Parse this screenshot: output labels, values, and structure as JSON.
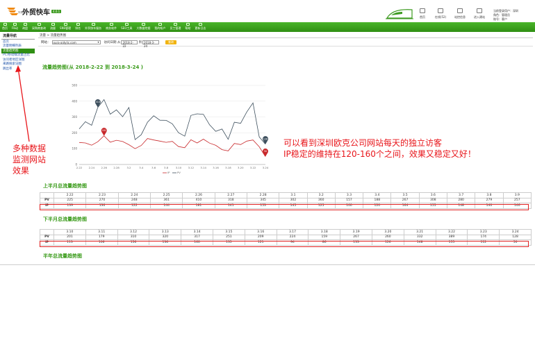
{
  "header": {
    "logo_text": "外贸快车",
    "logo_badge": "4.0.1",
    "logo_slogan": "外贸推广 快人一步",
    "top_links": [
      "首页",
      "在线(52)",
      "站控信息",
      "进入建站"
    ],
    "user_lines": [
      "当前登录用户：深圳",
      "角色：管理员",
      "账号：客户"
    ]
  },
  "nav": {
    "items": [
      "首页",
      "FB动",
      "询盘",
      "采购商查询",
      "流量",
      "SNS管理",
      "排名",
      "外贸快车服务",
      "商务软件",
      "SEO工具",
      "大数据挖掘",
      "我的帐户",
      "员工管理",
      "帮助",
      "更新日志"
    ]
  },
  "sidebar": {
    "title": "流量导航",
    "items": [
      "首页",
      "流量明细列表",
      "流量趋势图",
      "PC/移动端流量占比",
      "访问者地区详图",
      "来路搜索词图",
      "跳出率"
    ],
    "active_index": 2
  },
  "breadcrumb": {
    "home": "流量",
    "sep": " > ",
    "current": "流量趋势图"
  },
  "filter": {
    "site_label": "网站：",
    "site_value": "oura-aidylic.com",
    "date_label": "访问日期 从",
    "date_from": "2018-2-22",
    "date_to_label": "到",
    "date_to": "2018-3-24",
    "query_label": "查询"
  },
  "chart_title": "流量趋势图(从 2018-2-22 到 2018-3-24 )",
  "chart_data": {
    "type": "line",
    "x": [
      "2.22",
      "2.23",
      "2.24",
      "2.25",
      "2.26",
      "2.27",
      "2.28",
      "3.1",
      "3.2",
      "3.3",
      "3.4",
      "3.5",
      "3.6",
      "3.7",
      "3.8",
      "3.9",
      "3.10",
      "3.11",
      "3.12",
      "3.13",
      "3.14",
      "3.15",
      "3.16",
      "3.17",
      "3.18",
      "3.19",
      "3.20",
      "3.21",
      "3.22",
      "3.23",
      "3.24"
    ],
    "x_ticks": [
      "2.22",
      "2.24",
      "2.26",
      "2.28",
      "3.2",
      "3.4",
      "3.6",
      "3.8",
      "3.10",
      "3.12",
      "3.14",
      "3.16",
      "3.18",
      "3.20",
      "3.22",
      "3.24"
    ],
    "series": [
      {
        "name": "PV",
        "values": [
          225,
          270,
          248,
          361,
          410,
          318,
          345,
          302,
          360,
          157,
          188,
          267,
          308,
          280,
          279,
          257,
          201,
          179,
          310,
          320,
          317,
          251,
          209,
          224,
          159,
          267,
          260,
          332,
          389,
          174,
          128
        ],
        "color": "#3d4f5d"
      },
      {
        "name": "IP",
        "values": [
          139,
          136,
          122,
          144,
          181,
          141,
          153,
          145,
          125,
          100,
          120,
          164,
          155,
          148,
          140,
          146,
          113,
          106,
          156,
          136,
          160,
          135,
          121,
          94,
          86,
          133,
          126,
          148,
          155,
          112,
          50
        ],
        "color": "#c8282b"
      }
    ],
    "ylim": [
      0,
      500
    ],
    "y_ticks": [
      0,
      100,
      200,
      300,
      400,
      500
    ],
    "markers": [
      {
        "series": 0,
        "index": 3,
        "label": "410"
      },
      {
        "series": 1,
        "index": 4,
        "label": "181"
      },
      {
        "series": 0,
        "index": 30,
        "label": "128"
      },
      {
        "series": 1,
        "index": 30,
        "label": "50"
      }
    ],
    "legend": [
      "IP",
      "PV"
    ]
  },
  "first_half": {
    "title": "上半月总流量趋势图",
    "dates": [
      "2.22",
      "2.23",
      "2.24",
      "2.25",
      "2.26",
      "2.27",
      "2.28",
      "3.1",
      "3.2",
      "3.3",
      "3.4",
      "3.5",
      "3.6",
      "3.7",
      "3.8",
      "3.9"
    ],
    "pv": [
      "225",
      "270",
      "248",
      "361",
      "410",
      "318",
      "345",
      "302",
      "360",
      "157",
      "188",
      "267",
      "308",
      "280",
      "279",
      "257"
    ],
    "ip": [
      "139",
      "136",
      "122",
      "144",
      "181",
      "141",
      "153",
      "145",
      "125",
      "100",
      "120",
      "164",
      "155",
      "148",
      "140",
      "146"
    ]
  },
  "second_half": {
    "title": "下半月总流量趋势图",
    "dates": [
      "3.10",
      "3.11",
      "3.12",
      "3.13",
      "3.14",
      "3.15",
      "3.16",
      "3.17",
      "3.18",
      "3.19",
      "3.20",
      "3.21",
      "3.22",
      "3.23",
      "3.24"
    ],
    "pv": [
      "201",
      "179",
      "310",
      "320",
      "317",
      "251",
      "209",
      "224",
      "159",
      "267",
      "260",
      "332",
      "389",
      "174",
      "128"
    ],
    "ip": [
      "113",
      "106",
      "156",
      "136",
      "160",
      "135",
      "121",
      "94",
      "86",
      "133",
      "126",
      "148",
      "155",
      "112",
      "50"
    ]
  },
  "row_labels": {
    "pv": "PV",
    "ip": "IP"
  },
  "half_year_title": "半年总流量趋势图",
  "annotations": {
    "right_line1": "可以看到深圳欧克公司网站每天的独立访客",
    "right_line2": "IP稳定的维持在120-160个之间，效果又稳定又好！",
    "left_line1": "多种数据",
    "left_line2": "监测网站",
    "left_line3": "效果"
  },
  "colors": {
    "brand_green": "#3c9a1f",
    "annotation_red": "#e8161b",
    "query_yellow": "#f1b411"
  }
}
